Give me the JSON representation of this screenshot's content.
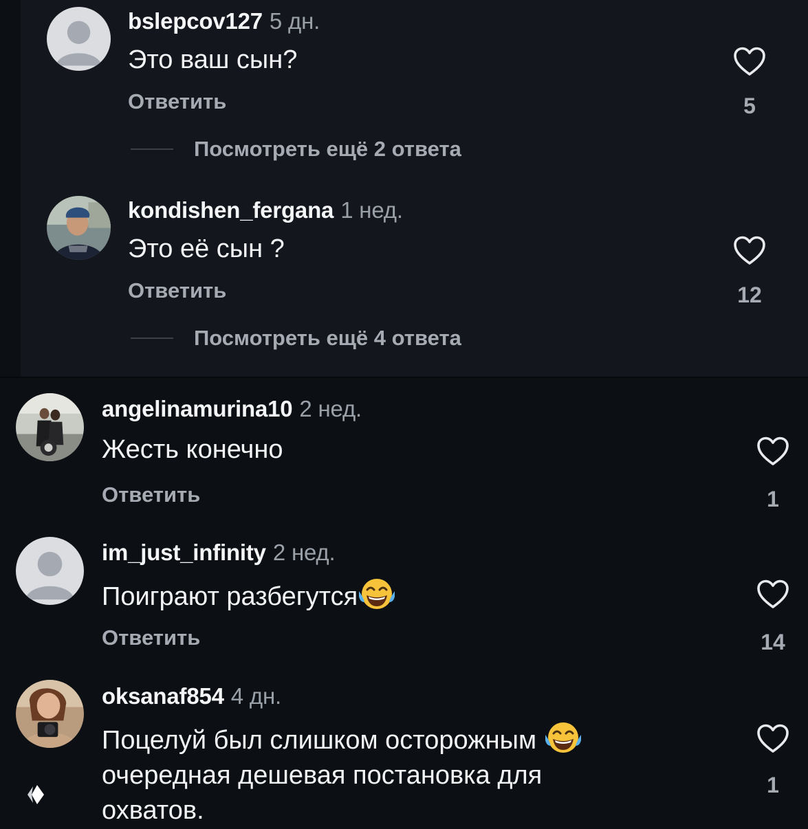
{
  "reply_label": "Ответить",
  "comments": [
    {
      "username": "bslepcov127",
      "time": "5 дн.",
      "text": "Это ваш сын?",
      "likes": "5",
      "more_replies": "Посмотреть ещё 2 ответа",
      "avatar": "default-avatar"
    },
    {
      "username": "kondishen_fergana",
      "time": "1 нед.",
      "text": "Это её сын ?",
      "likes": "12",
      "more_replies": "Посмотреть ещё 4 ответа",
      "avatar": "photo-avatar"
    },
    {
      "username": "angelinamurina10",
      "time": "2 нед.",
      "text": "Жесть конечно",
      "likes": "1",
      "avatar": "photo-avatar"
    },
    {
      "username": "im_just_infinity",
      "time": "2 нед.",
      "text": "Поиграют разбегутся",
      "likes": "14",
      "avatar": "default-avatar",
      "emoji": "face-with-tears-of-joy"
    },
    {
      "username": "oksanaf854",
      "time": "4 дн.",
      "text_lines": [
        "Поцелуй был слишком осторожным",
        "очередная дешевая постановка для",
        "охватов."
      ],
      "likes": "1",
      "avatar": "photo-avatar",
      "emoji": "face-with-tears-of-joy"
    }
  ],
  "colors": {
    "background": "#0c0f14",
    "reply_block": "#13161c",
    "secondary_text": "#a6abb3"
  },
  "icons": [
    "heart-icon",
    "default-avatar-icon",
    "laughing-emoji-icon",
    "watermark-logo-icon"
  ]
}
